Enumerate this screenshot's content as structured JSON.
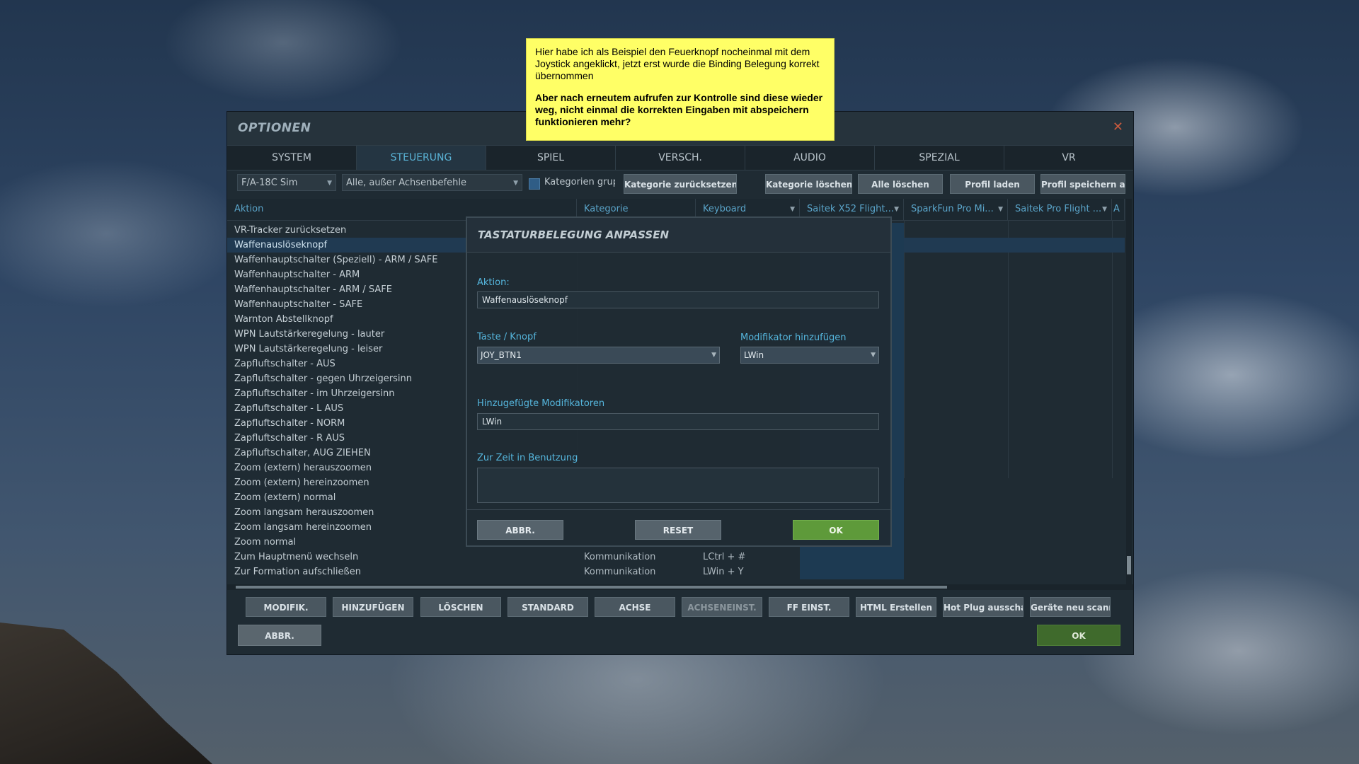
{
  "note": {
    "line1": "Hier habe ich als Beispiel den Feuerknopf nocheinmal mit dem Joystick angeklickt, jetzt erst wurde die Binding Belegung korrekt übernommen",
    "line2": "Aber nach erneutem aufrufen zur Kontrolle sind diese wieder weg, nicht einmal die korrekten Eingaben mit abspeichern funktionieren mehr?"
  },
  "window": {
    "title": "OPTIONEN",
    "close_icon": "close-icon",
    "tabs": [
      {
        "label": "SYSTEM"
      },
      {
        "label": "STEUERUNG",
        "active": true
      },
      {
        "label": "SPIEL"
      },
      {
        "label": "VERSCH."
      },
      {
        "label": "AUDIO"
      },
      {
        "label": "SPEZIAL"
      },
      {
        "label": "VR"
      }
    ]
  },
  "toolbar": {
    "aircraft_select": "F/A-18C Sim",
    "filter_select": "Alle, außer Achsenbefehle",
    "group_categories_label": "Kategorien gruppi",
    "buttons": [
      "Kategorie zurücksetzen",
      "Kategorie löschen",
      "Alle löschen",
      "Profil laden",
      "Profil speichern als"
    ]
  },
  "table": {
    "headers": [
      "Aktion",
      "Kategorie",
      "Keyboard",
      "Saitek X52 Flight...",
      "SparkFun Pro Mi...",
      "Saitek Pro Flight ...",
      "A"
    ],
    "rows": [
      {
        "action": "VR-Tracker zurücksetzen",
        "category": "",
        "keyboard": ""
      },
      {
        "action": "Waffenauslöseknopf",
        "category": "",
        "keyboard": "",
        "selected": true
      },
      {
        "action": "Waffenhauptschalter (Speziell) - ARM / SAFE",
        "category": "",
        "keyboard": ""
      },
      {
        "action": "Waffenhauptschalter - ARM",
        "category": "",
        "keyboard": ""
      },
      {
        "action": "Waffenhauptschalter - ARM / SAFE",
        "category": "",
        "keyboard": ""
      },
      {
        "action": "Waffenhauptschalter - SAFE",
        "category": "",
        "keyboard": ""
      },
      {
        "action": "Warnton Abstellknopf",
        "category": "",
        "keyboard": ""
      },
      {
        "action": "WPN Lautstärkeregelung - lauter",
        "category": "",
        "keyboard": ""
      },
      {
        "action": "WPN Lautstärkeregelung - leiser",
        "category": "",
        "keyboard": ""
      },
      {
        "action": "Zapfluftschalter - AUS",
        "category": "",
        "keyboard": ""
      },
      {
        "action": "Zapfluftschalter - gegen Uhrzeigersinn",
        "category": "",
        "keyboard": ""
      },
      {
        "action": "Zapfluftschalter - im Uhrzeigersinn",
        "category": "",
        "keyboard": ""
      },
      {
        "action": "Zapfluftschalter - L AUS",
        "category": "",
        "keyboard": ""
      },
      {
        "action": "Zapfluftschalter - NORM",
        "category": "",
        "keyboard": ""
      },
      {
        "action": "Zapfluftschalter - R AUS",
        "category": "",
        "keyboard": ""
      },
      {
        "action": "Zapfluftschalter, AUG ZIEHEN",
        "category": "",
        "keyboard": ""
      },
      {
        "action": "Zoom (extern) herauszoomen",
        "category": "",
        "keyboard": ""
      },
      {
        "action": "Zoom (extern) hereinzoomen",
        "category": "",
        "keyboard": ""
      },
      {
        "action": "Zoom (extern) normal",
        "category": "",
        "keyboard": ""
      },
      {
        "action": "Zoom langsam herauszoomen",
        "category": "",
        "keyboard": ""
      },
      {
        "action": "Zoom langsam hereinzoomen",
        "category": "",
        "keyboard": ""
      },
      {
        "action": "Zoom normal",
        "category": "",
        "keyboard": ""
      },
      {
        "action": "Zum Hauptmenü wechseln",
        "category": "Kommunikation",
        "keyboard": "LCtrl + #"
      },
      {
        "action": "Zur Formation aufschließen",
        "category": "Kommunikation",
        "keyboard": "LWin + Y"
      }
    ]
  },
  "bottom_buttons": [
    "MODIFIK.",
    "HINZUFÜGEN",
    "LÖSCHEN",
    "STANDARD",
    "ACHSE",
    "ACHSENEINST.",
    "FF EINST.",
    "HTML Erstellen",
    "Hot Plug ausschalten",
    "Geräte neu scannen"
  ],
  "footer": {
    "cancel": "ABBR.",
    "ok": "OK"
  },
  "dialog": {
    "title": "TASTATURBELEGUNG ANPASSEN",
    "action_label": "Aktion:",
    "action_value": "Waffenauslöseknopf",
    "key_label": "Taste / Knopf",
    "key_value": "JOY_BTN1",
    "modifier_label": "Modifikator hinzufügen",
    "modifier_value": "LWin",
    "added_modifiers_label": "Hinzugefügte Modifikatoren",
    "added_modifiers_value": "LWin",
    "in_use_label": "Zur Zeit in Benutzung",
    "in_use_value": "",
    "cancel": "ABBR.",
    "reset": "RESET",
    "ok": "OK"
  },
  "colors": {
    "accent": "#5ab3d6",
    "ok_green": "#5e9a3a",
    "note_yellow": "#ffff66"
  }
}
